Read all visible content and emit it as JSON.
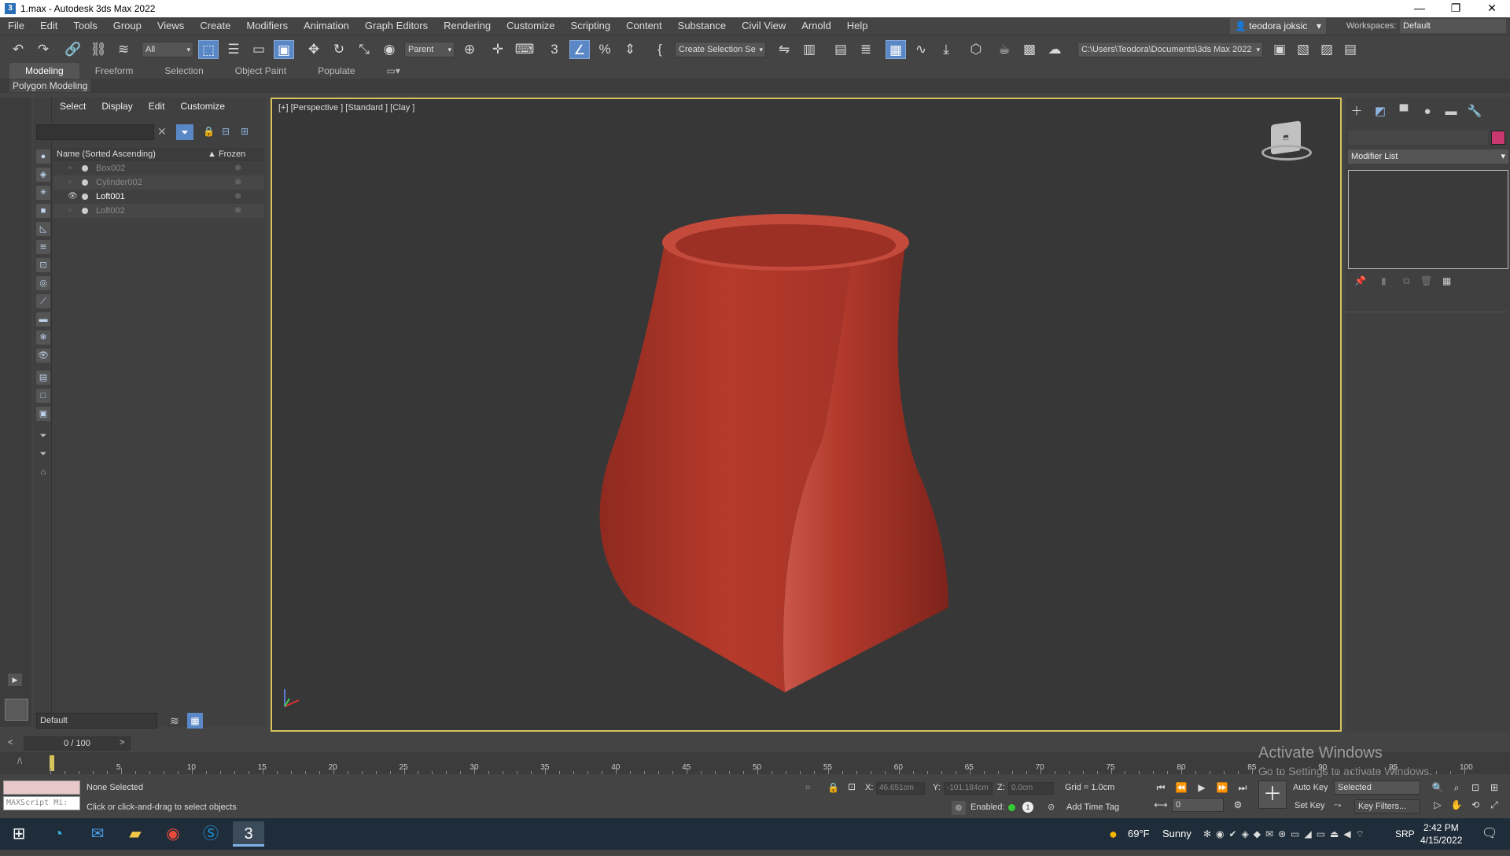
{
  "window": {
    "title": "1.max - Autodesk 3ds Max 2022",
    "minimize": "—",
    "restore": "❐",
    "close": "✕"
  },
  "menu": [
    "File",
    "Edit",
    "Tools",
    "Group",
    "Views",
    "Create",
    "Modifiers",
    "Animation",
    "Graph Editors",
    "Rendering",
    "Customize",
    "Scripting",
    "Content",
    "Substance",
    "Civil View",
    "Arnold",
    "Help"
  ],
  "account": {
    "user": "teodora joksic",
    "workspaces_label": "Workspaces:",
    "workspace": "Default"
  },
  "toolbar": {
    "selection_filter": "All",
    "reference_coord": "Parent",
    "named_selection": "Create Selection Se",
    "project_path": "C:\\Users\\Teodora\\Documents\\3ds Max 2022"
  },
  "ribbon": {
    "tabs": [
      "Modeling",
      "Freeform",
      "Selection",
      "Object Paint",
      "Populate"
    ],
    "active": "Modeling",
    "panel": "Polygon Modeling"
  },
  "scene_explorer": {
    "menu": [
      "Select",
      "Display",
      "Edit",
      "Customize"
    ],
    "columns": {
      "name": "Name (Sorted Ascending)",
      "frozen": "▲ Frozen"
    },
    "rows": [
      {
        "name": "Box002",
        "visible": false
      },
      {
        "name": "Cylinder002",
        "visible": false
      },
      {
        "name": "Loft001",
        "visible": true
      },
      {
        "name": "Loft002",
        "visible": false
      }
    ],
    "layer": "Default"
  },
  "viewport": {
    "label": "[+] [Perspective ] [Standard ] [Clay ]",
    "object_color": "#b23a2e"
  },
  "command_panel": {
    "modifier_list": "Modifier List",
    "object_color": "#c8386e"
  },
  "time": {
    "frame": "0 / 100",
    "ticks": [
      "5",
      "10",
      "15",
      "20",
      "25",
      "30",
      "35",
      "40",
      "45",
      "50",
      "55",
      "60",
      "65",
      "70",
      "75",
      "80",
      "85",
      "90",
      "95",
      "100"
    ]
  },
  "status": {
    "selection": "None Selected",
    "prompt": "Click or click-and-drag to select objects",
    "maxscript": "MAXScript Mi:",
    "x_label": "X:",
    "x": "46.651cm",
    "y_label": "Y:",
    "y": "-101.184cm",
    "z_label": "Z:",
    "z": "0.0cm",
    "grid": "Grid = 1.0cm",
    "enabled": "Enabled:",
    "add_time_tag": "Add Time Tag",
    "auto_key": "Auto Key",
    "set_key": "Set Key",
    "key_mode": "Selected",
    "key_filters": "Key Filters...",
    "frame_field": "0"
  },
  "watermark": {
    "line1": "Activate Windows",
    "line2": "Go to Settings to activate Windows."
  },
  "taskbar": {
    "weather_temp": "69°F",
    "weather": "Sunny",
    "lang": "SRP",
    "time": "2:42 PM",
    "date": "4/15/2022"
  }
}
